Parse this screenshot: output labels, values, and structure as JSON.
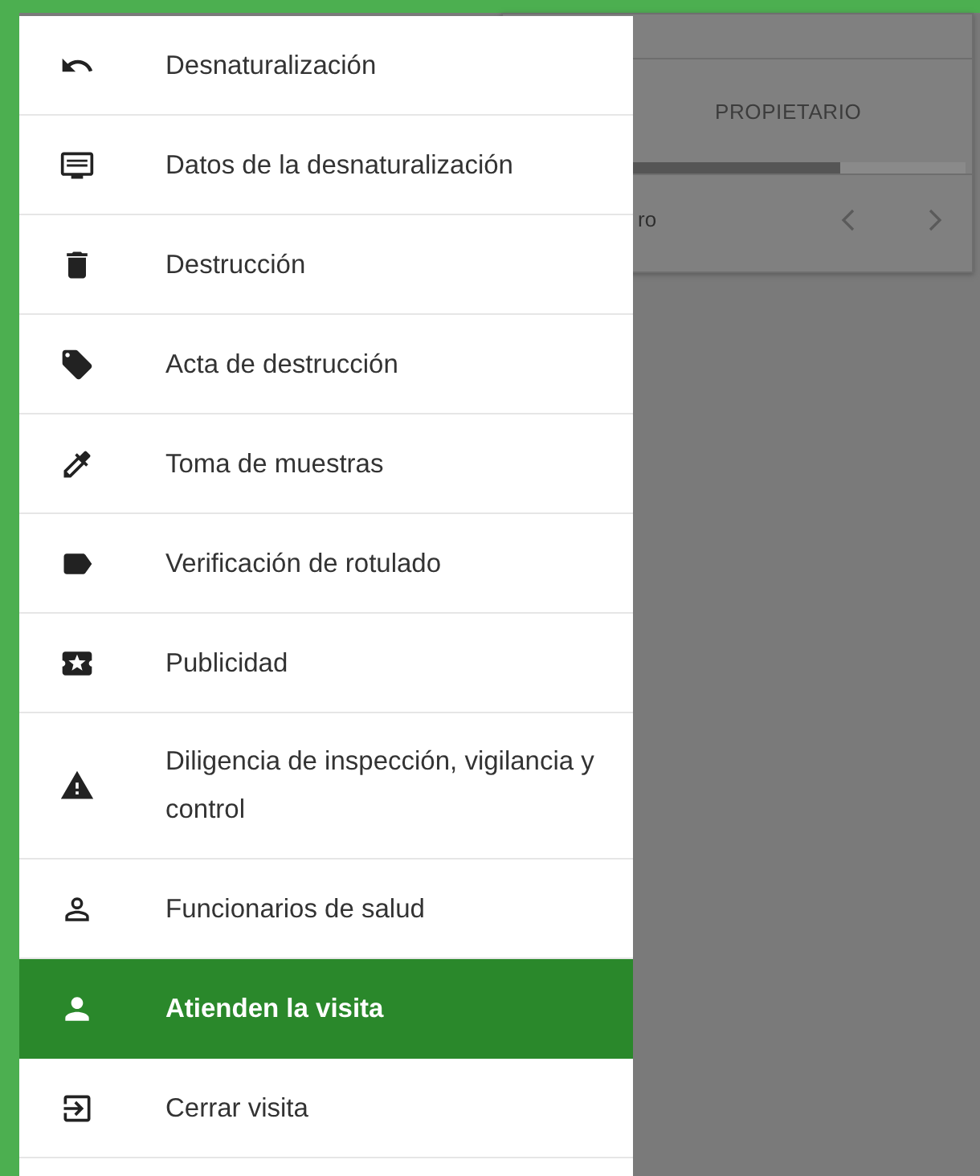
{
  "drawer": {
    "items": [
      {
        "label": "Desnaturalización",
        "selected": false
      },
      {
        "label": "Datos de la desnaturalización",
        "selected": false
      },
      {
        "label": "Destrucción",
        "selected": false
      },
      {
        "label": "Acta de destrucción",
        "selected": false
      },
      {
        "label": "Toma de muestras",
        "selected": false
      },
      {
        "label": "Verificación de rotulado",
        "selected": false
      },
      {
        "label": "Publicidad",
        "selected": false
      },
      {
        "label": "Diligencia de inspección, vigilancia y control",
        "selected": false
      },
      {
        "label": "Funcionarios de salud",
        "selected": false
      },
      {
        "label": "Atienden la visita",
        "selected": true
      },
      {
        "label": "Cerrar visita",
        "selected": false
      }
    ]
  },
  "background_table": {
    "column_header": "PROPIETARIO",
    "footer_text": "ro"
  }
}
